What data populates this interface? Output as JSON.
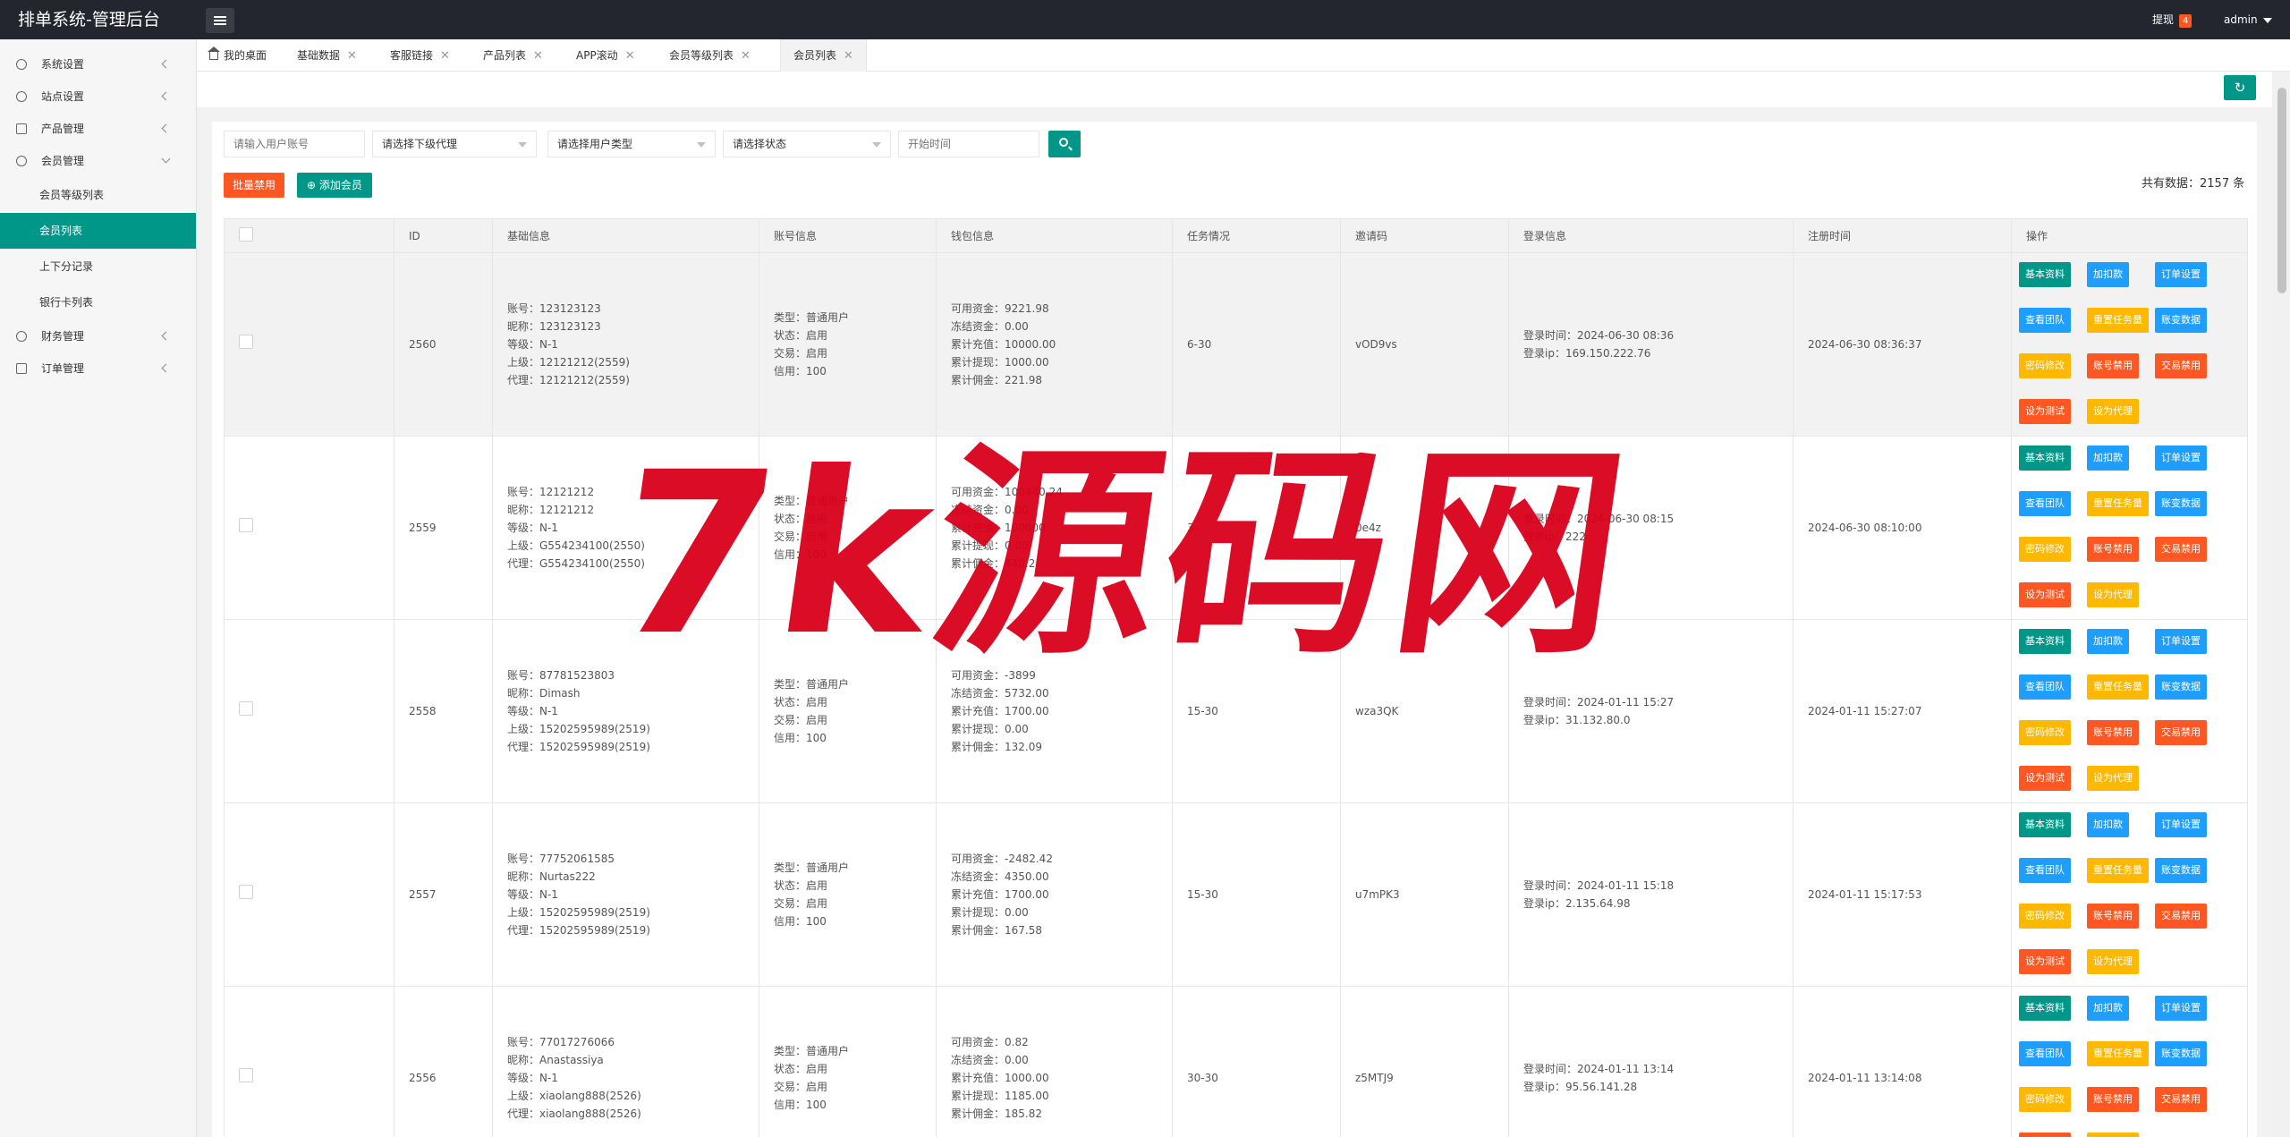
{
  "header": {
    "title": "排单系统-管理后台",
    "withdraw_label": "提现",
    "withdraw_badge": "4",
    "user": "admin"
  },
  "sidebar": {
    "items": [
      {
        "label": "系统设置",
        "icon": "gear-icon"
      },
      {
        "label": "站点设置",
        "icon": "site-icon"
      },
      {
        "label": "产品管理",
        "icon": "product-icon"
      },
      {
        "label": "会员管理",
        "icon": "user-icon"
      },
      {
        "label": "财务管理",
        "icon": "finance-icon"
      },
      {
        "label": "订单管理",
        "icon": "order-icon"
      }
    ],
    "sub_items": [
      "会员等级列表",
      "会员列表",
      "上下分记录",
      "银行卡列表"
    ]
  },
  "tabs": [
    {
      "label": "我的桌面"
    },
    {
      "label": "基础数据"
    },
    {
      "label": "客服链接"
    },
    {
      "label": "产品列表"
    },
    {
      "label": "APP滚动"
    },
    {
      "label": "会员等级列表"
    },
    {
      "label": "会员列表"
    }
  ],
  "filters": {
    "account_placeholder": "请输入用户账号",
    "agent_select": "请选择下级代理",
    "type_select": "请选择用户类型",
    "status_select": "请选择状态",
    "time_placeholder": "开始时间"
  },
  "actions": {
    "batch_disable": "批量禁用",
    "add_member": "添加会员",
    "total": "共有数据：2157 条"
  },
  "table": {
    "headers": [
      "",
      "ID",
      "基础信息",
      "账号信息",
      "钱包信息",
      "任务情况",
      "邀请码",
      "登录信息",
      "注册时间",
      "操作"
    ],
    "op_buttons": [
      "基本资料",
      "加扣款",
      "订单设置",
      "查看团队",
      "重置任务量",
      "账变数据",
      "密码修改",
      "账号禁用",
      "交易禁用",
      "设为测试",
      "设为代理"
    ],
    "rows": [
      {
        "id": "2560",
        "basic": [
          "账号：123123123",
          "昵称：123123123",
          "等级：N-1",
          "上级：12121212(2559)",
          "代理：12121212(2559)"
        ],
        "account": [
          "类型：普通用户",
          "状态：启用",
          "交易：启用",
          "信用：100"
        ],
        "wallet": [
          "可用资金：9221.98",
          "冻结资金：0.00",
          "累计充值：10000.00",
          "累计提现：1000.00",
          "累计佣金：221.98"
        ],
        "task": "6-30",
        "invite": "vOD9vs",
        "login": [
          "登录时间：2024-06-30 08:36",
          "登录ip：169.150.222.76"
        ],
        "reg": "2024-06-30 08:36:37"
      },
      {
        "id": "2559",
        "basic": [
          "账号：12121212",
          "昵称：12121212",
          "等级：N-1",
          "上级：G554234100(2550)",
          "代理：G554234100(2550)"
        ],
        "account": [
          "类型：普通用户",
          "状态：启用",
          "交易：启用",
          "信用：100"
        ],
        "wallet": [
          "可用资金：100440.24",
          "冻结资金：0.00",
          "累计充值：100000",
          "累计提现：0.00",
          "累计佣金：440.2"
        ],
        "task": "3-",
        "invite": "0e4z",
        "login": [
          "登录时间：2024-06-30 08:15",
          "登录ip：222"
        ],
        "reg": "2024-06-30 08:10:00"
      },
      {
        "id": "2558",
        "basic": [
          "账号：87781523803",
          "昵称：Dimash",
          "等级：N-1",
          "上级：15202595989(2519)",
          "代理：15202595989(2519)"
        ],
        "account": [
          "类型：普通用户",
          "状态：启用",
          "交易：启用",
          "信用：100"
        ],
        "wallet": [
          "可用资金：-3899",
          "冻结资金：5732.00",
          "累计充值：1700.00",
          "累计提现：0.00",
          "累计佣金：132.09"
        ],
        "task": "15-30",
        "invite": "wza3QK",
        "login": [
          "登录时间：2024-01-11 15:27",
          "登录ip：31.132.80.0"
        ],
        "reg": "2024-01-11 15:27:07"
      },
      {
        "id": "2557",
        "basic": [
          "账号：77752061585",
          "昵称：Nurtas222",
          "等级：N-1",
          "上级：15202595989(2519)",
          "代理：15202595989(2519)"
        ],
        "account": [
          "类型：普通用户",
          "状态：启用",
          "交易：启用",
          "信用：100"
        ],
        "wallet": [
          "可用资金：-2482.42",
          "冻结资金：4350.00",
          "累计充值：1700.00",
          "累计提现：0.00",
          "累计佣金：167.58"
        ],
        "task": "15-30",
        "invite": "u7mPK3",
        "login": [
          "登录时间：2024-01-11 15:18",
          "登录ip：2.135.64.98"
        ],
        "reg": "2024-01-11 15:17:53"
      },
      {
        "id": "2556",
        "basic": [
          "账号：77017276066",
          "昵称：Anastassiya",
          "等级：N-1",
          "上级：xiaolang888(2526)",
          "代理：xiaolang888(2526)"
        ],
        "account": [
          "类型：普通用户",
          "状态：启用",
          "交易：启用",
          "信用：100"
        ],
        "wallet": [
          "可用资金：0.82",
          "冻结资金：0.00",
          "累计充值：1000.00",
          "累计提现：1185.00",
          "累计佣金：185.82"
        ],
        "task": "30-30",
        "invite": "z5MTJ9",
        "login": [
          "登录时间：2024-01-11 13:14",
          "登录ip：95.56.141.28"
        ],
        "reg": "2024-01-11 13:14:08"
      }
    ]
  },
  "watermark": "7k源码网"
}
